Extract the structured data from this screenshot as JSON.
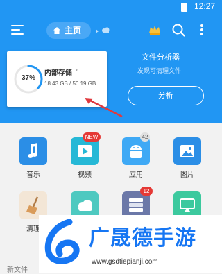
{
  "status_bar": {
    "time": "12:27"
  },
  "toolbar": {
    "home_label": "主页"
  },
  "storage": {
    "percent_label": "37%",
    "percent_value": 0.37,
    "title": "内部存储",
    "size_text": "18.43 GB / 50.19 GB"
  },
  "analyzer": {
    "title": "文件分析器",
    "subtitle": "发现可清理文件",
    "button_label": "分析"
  },
  "grid": {
    "items": [
      {
        "label": "音乐",
        "icon": "music-icon",
        "color": "#2b8ee6"
      },
      {
        "label": "视频",
        "icon": "video-play-icon",
        "color": "#26b8d6",
        "badge": "NEW"
      },
      {
        "label": "应用",
        "icon": "android-icon",
        "color": "#3fa9f5",
        "badge": "42"
      },
      {
        "label": "图片",
        "icon": "image-icon",
        "color": "#2b8ee6"
      },
      {
        "label": "清理",
        "icon": "broom-icon",
        "color": "#f6a04d"
      },
      {
        "label": "",
        "icon": "cloud-icon",
        "color": "#4ec9c0"
      },
      {
        "label": "",
        "icon": "download-stack-icon",
        "color": "#6b78a8",
        "badge": "12"
      },
      {
        "label": "",
        "icon": "cast-icon",
        "color": "#3cc99e"
      }
    ]
  },
  "recent": {
    "label": "新文件"
  },
  "watermark": {
    "brand": "广晟德手游",
    "url": "www.gsdtiepianji.com"
  },
  "colors": {
    "primary": "#2196f3",
    "badge_red": "#e53935",
    "arrow_red": "#e0393e",
    "brand_blue": "#1676f3"
  }
}
